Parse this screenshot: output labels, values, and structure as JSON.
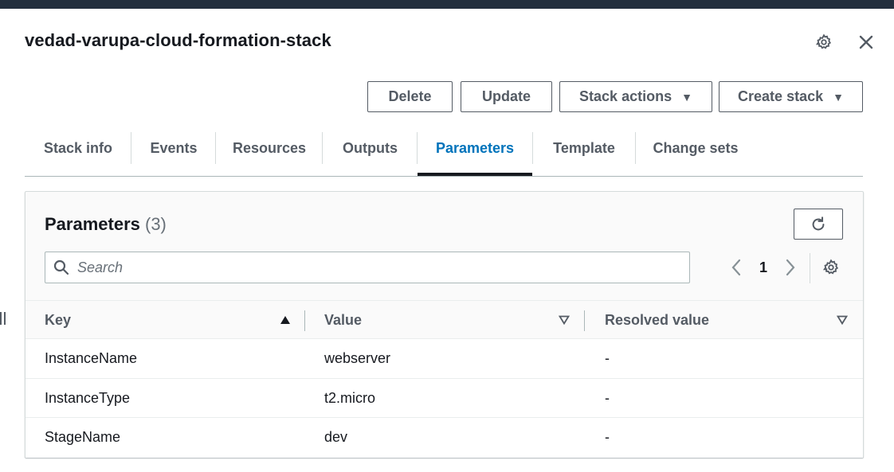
{
  "header": {
    "stack_name": "vedad-varupa-cloud-formation-stack",
    "settings_icon": "gear-icon",
    "close_icon": "close-icon"
  },
  "actions": {
    "delete_label": "Delete",
    "update_label": "Update",
    "stack_actions_label": "Stack actions",
    "create_stack_label": "Create stack"
  },
  "tabs": [
    {
      "label": "Stack info",
      "active": false
    },
    {
      "label": "Events",
      "active": false
    },
    {
      "label": "Resources",
      "active": false
    },
    {
      "label": "Outputs",
      "active": false
    },
    {
      "label": "Parameters",
      "active": true
    },
    {
      "label": "Template",
      "active": false
    },
    {
      "label": "Change sets",
      "active": false
    }
  ],
  "parameters_panel": {
    "title": "Parameters",
    "count": "(3)",
    "search_placeholder": "Search",
    "current_page": "1",
    "columns": [
      "Key",
      "Value",
      "Resolved value"
    ],
    "rows": [
      {
        "key": "InstanceName",
        "value": "webserver",
        "resolved": "-"
      },
      {
        "key": "InstanceType",
        "value": "t2.micro",
        "resolved": "-"
      },
      {
        "key": "StageName",
        "value": "dev",
        "resolved": "-"
      }
    ]
  },
  "colors": {
    "topbar": "#232f3e",
    "active_tab": "#0073bb",
    "text": "#16191f",
    "secondary_text": "#545b64"
  }
}
